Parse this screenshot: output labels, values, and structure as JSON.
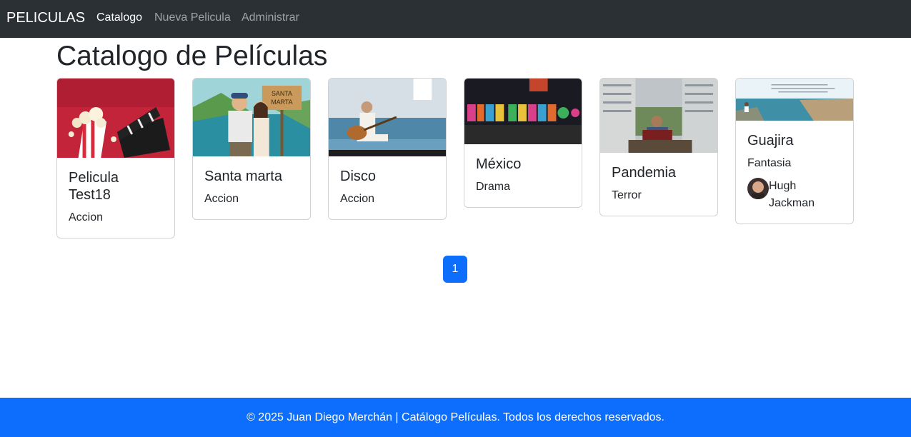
{
  "navbar": {
    "brand": "PELICULAS",
    "links": [
      {
        "label": "Catalogo",
        "active": true
      },
      {
        "label": "Nueva Pelicula",
        "active": false
      },
      {
        "label": "Administrar",
        "active": false
      }
    ]
  },
  "page": {
    "title": "Catalogo de Películas"
  },
  "movies": [
    {
      "title": "Pelicula Test18",
      "genre": "Accion",
      "image": "popcorn-clapperboard-image"
    },
    {
      "title": "Santa marta",
      "genre": "Accion",
      "image": "santa-marta-illustration-image"
    },
    {
      "title": "Disco",
      "genre": "Accion",
      "image": "guitarist-poster-image"
    },
    {
      "title": "México",
      "genre": "Drama",
      "image": "viva-mexico-sign-image"
    },
    {
      "title": "Pandemia",
      "genre": "Terror",
      "image": "accordion-player-buildings-image"
    },
    {
      "title": "Guajira",
      "genre": "Fantasia",
      "image": "coastal-landscape-image",
      "actor": "Hugh Jackman"
    }
  ],
  "pagination": {
    "current_page": "1"
  },
  "footer": {
    "text": "© 2025 Juan Diego Merchán | Catálogo Películas. Todos los derechos reservados."
  },
  "colors": {
    "navbar": "#2b3035",
    "primary": "#0d6efd",
    "text": "#212529"
  }
}
